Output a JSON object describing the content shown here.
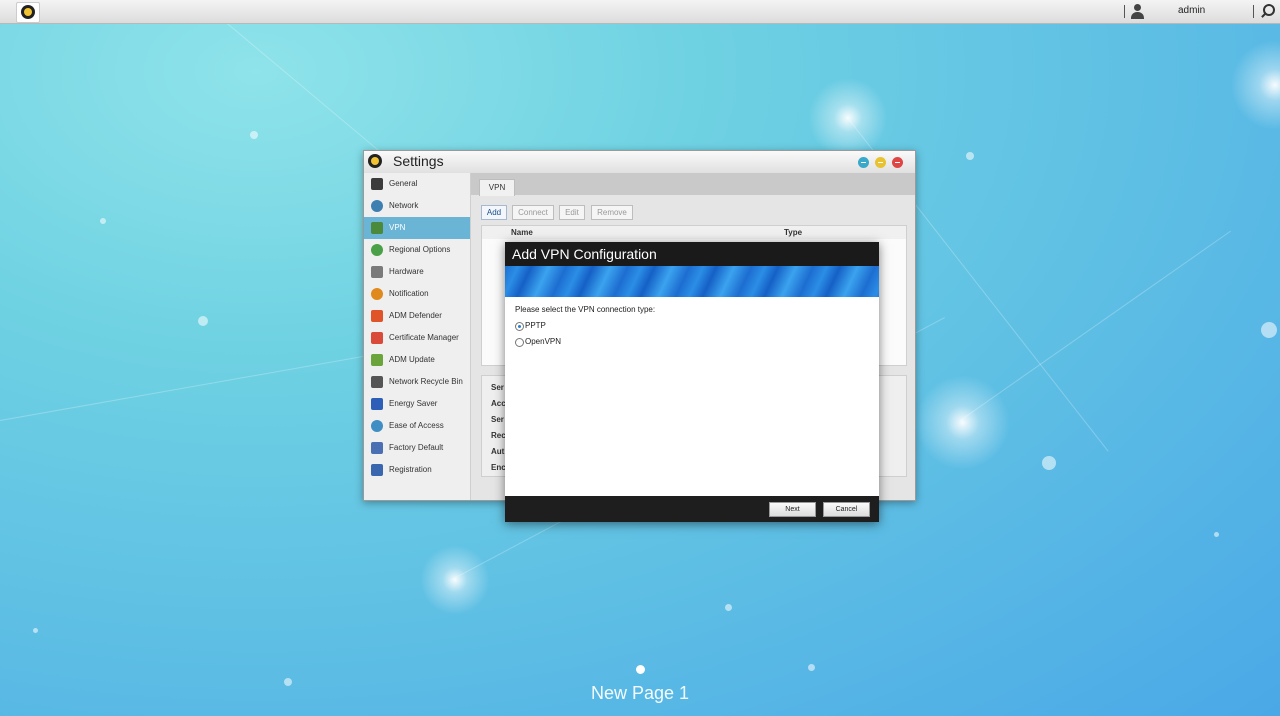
{
  "topbar": {
    "user": "admin"
  },
  "settings_window": {
    "title": "Settings",
    "sidebar": [
      {
        "label": "General",
        "color": "#3b3b3b"
      },
      {
        "label": "Network",
        "color": "#3e7fb1"
      },
      {
        "label": "VPN",
        "color": "#4a8a3a",
        "selected": true
      },
      {
        "label": "Regional Options",
        "color": "#4aa046"
      },
      {
        "label": "Hardware",
        "color": "#7a7a7a"
      },
      {
        "label": "Notification",
        "color": "#e08a1e"
      },
      {
        "label": "ADM Defender",
        "color": "#e0542a"
      },
      {
        "label": "Certificate Manager",
        "color": "#d94a3a"
      },
      {
        "label": "ADM Update",
        "color": "#6aa43a"
      },
      {
        "label": "Network Recycle Bin",
        "color": "#555555"
      },
      {
        "label": "Energy Saver",
        "color": "#2d5fb8"
      },
      {
        "label": "Ease of Access",
        "color": "#3f8ec4"
      },
      {
        "label": "Factory Default",
        "color": "#4a6fb3"
      },
      {
        "label": "Registration",
        "color": "#3a66b0"
      }
    ],
    "tab": "VPN",
    "toolbar": {
      "add": "Add",
      "connect": "Connect",
      "edit": "Edit",
      "remove": "Remove"
    },
    "grid_headers": {
      "name": "Name",
      "type": "Type"
    },
    "info_rows": [
      "Ser",
      "Acc",
      "Ser",
      "Rec",
      "Aut",
      "Enc"
    ]
  },
  "dialog": {
    "title": "Add VPN Configuration",
    "prompt": "Please select the VPN connection type:",
    "options": [
      {
        "label": "PPTP",
        "checked": true
      },
      {
        "label": "OpenVPN",
        "checked": false
      }
    ],
    "next": "Next",
    "cancel": "Cancel"
  },
  "desktop": {
    "page_name": "New Page 1"
  }
}
